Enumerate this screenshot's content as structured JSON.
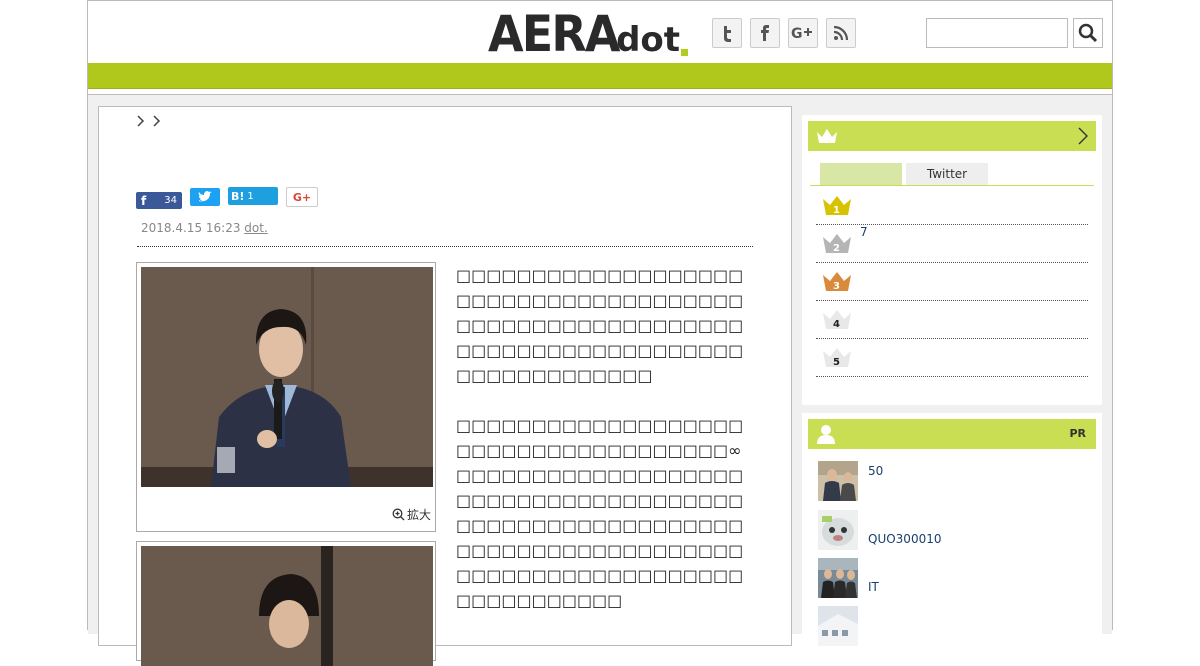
{
  "header": {
    "logo_main": "AERA",
    "logo_sub": "dot",
    "social": [
      {
        "icon": "twitter-icon",
        "glyph": "t"
      },
      {
        "icon": "facebook-icon",
        "glyph": "f"
      },
      {
        "icon": "google-plus-icon",
        "glyph": "G+"
      },
      {
        "icon": "rss-icon",
        "glyph": "rss"
      }
    ],
    "search_value": ""
  },
  "colors": {
    "brand_green": "#afc81b",
    "panel_green": "#c9de52",
    "link_blue": "#1a3f6e"
  },
  "article": {
    "share": {
      "facebook_count": "34",
      "hatena_label": "B!",
      "hatena_count": "1",
      "gplus_label": "G+"
    },
    "meta": {
      "date": "2018.4.15 16:23",
      "source": "dot."
    },
    "photo1_zoom": "拡大",
    "paragraphs": [
      "□□□□□□□□□□□□□□□□□□□□□□□□□□□□□□□□□□□□□□□□□□□□□□□□□□□□□□□□□□□□□□□□□□□□□□□□□□□□□□□□□□□□□□□□□",
      "□□□□□□□□□□□□□□□□□□□□□□□□□□□□□□□□□□□□□∞□□□□□□□□□□□□□□□□□□□□□□□□□□□□□□□□□□□□□□□□□□□□□□□□□□□□□□□□□□□□□□□□□□□□□□□□□□□□□□□□□□□□□□□□□□□□□□□□□□□□□□□□□□"
    ]
  },
  "ranking": {
    "tabs": [
      "",
      "Twitter"
    ],
    "items": [
      {
        "rank": "1",
        "text": "",
        "color": "#d8c300"
      },
      {
        "rank": "2",
        "text": "7",
        "color": "#b5b5b5"
      },
      {
        "rank": "3",
        "text": "",
        "color": "#d98a3a"
      },
      {
        "rank": "4",
        "text": "",
        "color": "#e8e8e8"
      },
      {
        "rank": "5",
        "text": "",
        "color": "#e8e8e8"
      }
    ]
  },
  "pr": {
    "label": "PR",
    "items": [
      {
        "text": "50"
      },
      {
        "text": "QUO300010"
      },
      {
        "text": "IT"
      },
      {
        "text": ""
      }
    ]
  }
}
